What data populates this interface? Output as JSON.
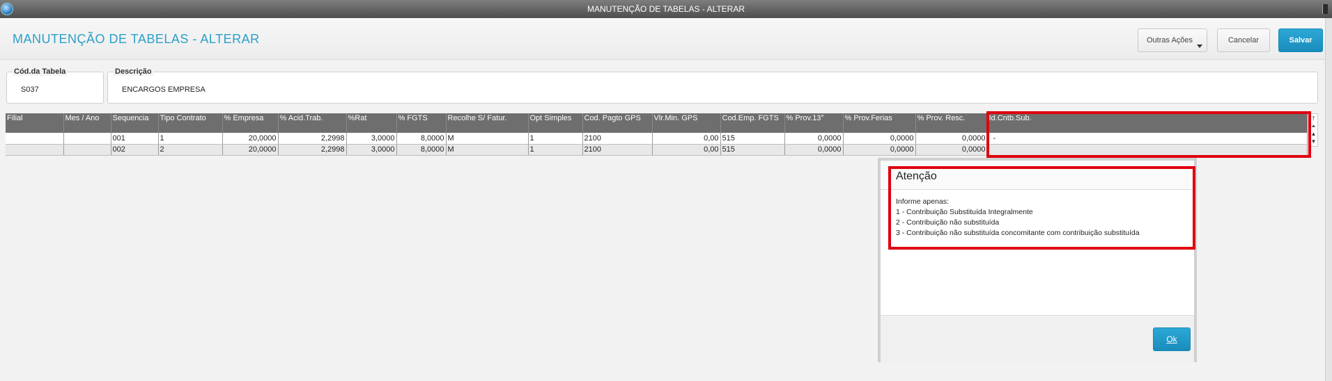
{
  "window": {
    "title": "MANUTENÇÃO DE TABELAS - ALTERAR",
    "icon": "app-globe-icon"
  },
  "header": {
    "title": "MANUTENÇÃO DE TABELAS - ALTERAR",
    "other_actions_label": "Outras Ações",
    "cancel_label": "Cancelar",
    "save_label": "Salvar"
  },
  "form": {
    "cod_label": "Cód.da Tabela",
    "cod_value": "S037",
    "desc_label": "Descrição",
    "desc_value": "ENCARGOS EMPRESA"
  },
  "grid": {
    "columns": [
      "Filial",
      "Mes / Ano",
      "Sequencia",
      "Tipo Contrato",
      "% Empresa",
      "% Acid.Trab.",
      "%Rat",
      "% FGTS",
      "Recolhe S/ Fatur.",
      "Opt Simples",
      "Cod. Pagto GPS",
      "Vlr.Min. GPS",
      "Cod.Emp. FGTS",
      "% Prov.13°",
      "% Prov.Ferias",
      "% Prov. Resc.",
      "Id.Cntb.Sub."
    ],
    "rows": [
      [
        "",
        "",
        "001",
        "1",
        "20,0000",
        "2,2998",
        "3,0000",
        "8,0000",
        "M",
        "1",
        "2100",
        "0,00",
        "515",
        "0,0000",
        "0,0000",
        "0,0000",
        "-"
      ],
      [
        "",
        "",
        "002",
        "2",
        "20,0000",
        "2,2998",
        "3,0000",
        "8,0000",
        "M",
        "1",
        "2100",
        "0,00",
        "515",
        "0,0000",
        "0,0000",
        "0,0000",
        ""
      ]
    ]
  },
  "dialog": {
    "title": "Atenção",
    "lines": [
      "Informe apenas:",
      "1 - Contribuição Substituída Integralmente",
      "2 - Contribuição não substituída",
      "3 - Contribuição não substituída concomitante com contribuição substituída"
    ],
    "ok_label": "Ok"
  },
  "colors": {
    "accent": "#1a8cbc",
    "title": "#2aa0c8",
    "highlight": "#e0000f",
    "grid_header": "#6e6e6e"
  }
}
